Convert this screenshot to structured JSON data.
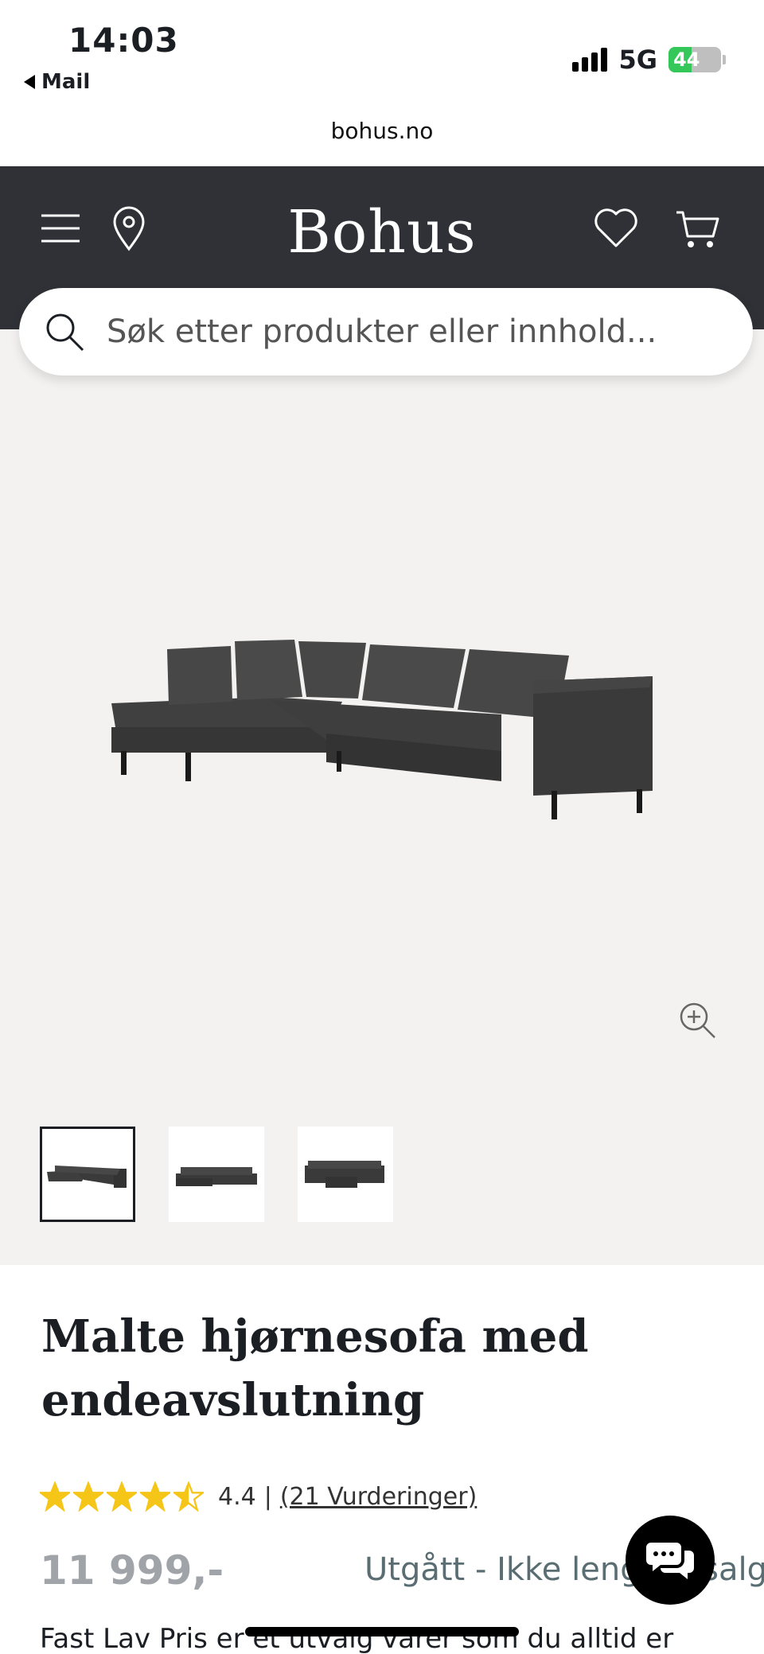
{
  "status_bar": {
    "time": "14:03",
    "back_label": "Mail",
    "network": "5G",
    "battery": "44"
  },
  "browser": {
    "url": "bohus.no"
  },
  "header": {
    "logo": "Bohus",
    "icons": [
      "menu-icon",
      "location-pin-icon",
      "heart-icon",
      "cart-icon"
    ],
    "background": "#2f3136"
  },
  "search": {
    "placeholder": "Søk etter produkter eller innhold..."
  },
  "gallery": {
    "background": "#f3f2f1",
    "thumbnails": 3,
    "active_thumbnail": 1
  },
  "product": {
    "title": "Malte hjørnesofa med endeavslutning",
    "rating": "4.4",
    "rating_stars": 4.5,
    "separator": "|",
    "reviews": "(21 Vurderinger)",
    "price": "11 999,-",
    "availability": "Utgått - Ikke lenger i salg",
    "description": "Fast Lav Pris er et utvalg varer som du alltid er"
  },
  "colors": {
    "star": "#f5c518",
    "availability": "#5a6d72",
    "price": "#a0a4a8"
  }
}
